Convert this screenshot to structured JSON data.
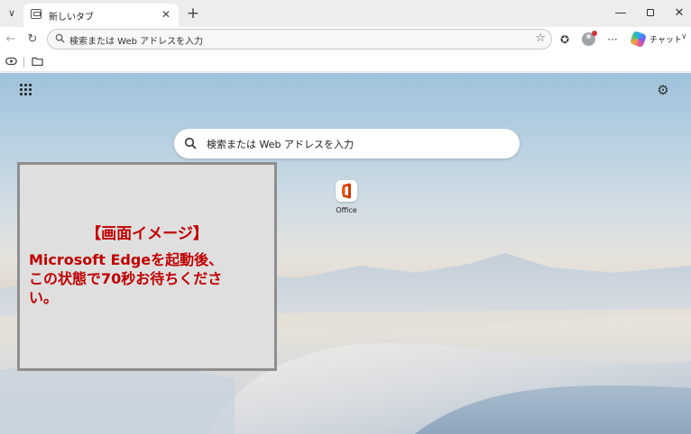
{
  "tab": {
    "title": "新しいタブ"
  },
  "address_bar": {
    "placeholder": "検索または Web アドレスを入力"
  },
  "copilot": {
    "label": "チャット"
  },
  "ntp": {
    "search_placeholder": "検索または Web アドレスを入力",
    "tiles": [
      {
        "label": "Office"
      }
    ]
  },
  "overlay": {
    "title": "【画面イメージ】",
    "lines": [
      "Microsoft Edgeを起動後、",
      "この状態で70秒お待ちくださ",
      "い。"
    ]
  },
  "icons": {
    "tab_list": "chevron-down-icon",
    "tab_favicon": "new-tab-page-icon",
    "close": "close-icon",
    "new_tab": "plus-icon",
    "back": "arrow-left-icon",
    "refresh": "refresh-icon",
    "search": "search-icon",
    "favorite": "star-icon",
    "favorites": "favorites-icon",
    "more": "more-icon",
    "workspaces": "workspaces-icon",
    "tab_actions": "folder-icon",
    "apps": "app-launcher-icon",
    "settings": "gear-icon"
  },
  "colors": {
    "overlay_text": "#c00000",
    "overlay_bg": "#dfdfdf",
    "overlay_border": "#8e8e8e",
    "office_red": "#d83b01",
    "profile_badge": "#d13438"
  }
}
